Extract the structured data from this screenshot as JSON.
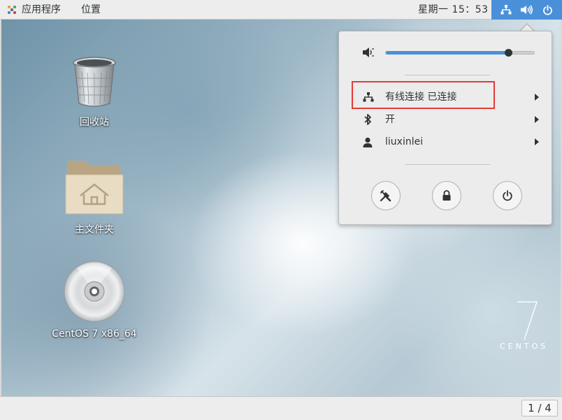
{
  "topbar": {
    "apps_label": "应用程序",
    "places_label": "位置",
    "clock": "星期一 15：53",
    "status_icons": [
      "network-wired-icon",
      "volume-icon",
      "power-icon"
    ],
    "status_bg": "#4a90d9"
  },
  "desktop": {
    "icons": [
      {
        "label": "回收站",
        "icon": "trash-icon"
      },
      {
        "label": "主文件夹",
        "icon": "home-folder-icon"
      },
      {
        "label": "CentOS 7 x86_64",
        "icon": "optical-disc-icon"
      }
    ],
    "brand_number": "7",
    "brand_text": "CENTOS"
  },
  "status_menu": {
    "volume_level": 0.83,
    "network": {
      "label": "有线连接 已连接",
      "icon": "network-wired-icon"
    },
    "bluetooth": {
      "label": "开",
      "icon": "bluetooth-icon"
    },
    "user": {
      "label": "liuxinlei",
      "icon": "user-icon"
    },
    "buttons": [
      "settings-icon",
      "lock-icon",
      "power-icon"
    ],
    "highlight_color": "#e53935"
  },
  "bottombar": {
    "workspace_indicator": "1 / 4"
  }
}
